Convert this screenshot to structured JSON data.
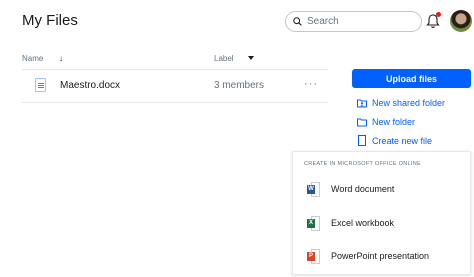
{
  "header": {
    "title": "My Files",
    "search": {
      "placeholder": "Search",
      "value": ""
    },
    "notification_dot_color": "#e02020"
  },
  "file_list": {
    "columns": {
      "name": "Name",
      "label": "Label"
    },
    "rows": [
      {
        "name": "Maestro.docx",
        "members": "3 members",
        "more": "···"
      }
    ]
  },
  "sidebar": {
    "upload_label": "Upload files",
    "actions": [
      {
        "label": "New shared folder",
        "icon": "shared-folder-icon"
      },
      {
        "label": "New folder",
        "icon": "folder-icon"
      },
      {
        "label": "Create new file",
        "icon": "new-file-icon"
      }
    ]
  },
  "office_panel": {
    "heading": "CREATE IN MICROSOFT OFFICE ONLINE",
    "items": [
      {
        "label": "Word document",
        "badge": "W",
        "color": "#2b579a"
      },
      {
        "label": "Excel workbook",
        "badge": "X",
        "color": "#217346"
      },
      {
        "label": "PowerPoint presentation",
        "badge": "P",
        "color": "#d24726"
      }
    ]
  },
  "colors": {
    "accent": "#0061fe",
    "text": "#1e1919",
    "muted": "#637282",
    "divider": "#e6e8eb"
  }
}
